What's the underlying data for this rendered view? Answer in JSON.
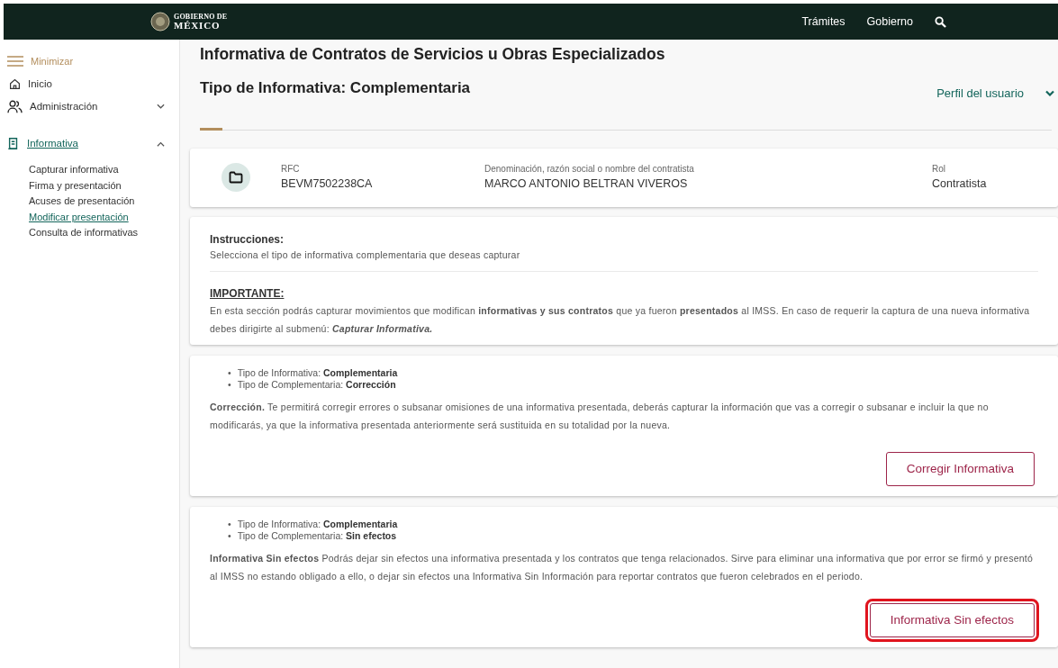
{
  "header": {
    "logo": {
      "line1": "GOBIERNO DE",
      "line2": "MÉXICO"
    },
    "links": [
      "Trámites",
      "Gobierno"
    ]
  },
  "sidebar": {
    "minimize": "Minimizar",
    "items": [
      {
        "label": "Inicio",
        "kind": "home",
        "selected": false
      },
      {
        "label": "Administración",
        "kind": "group",
        "selected": false,
        "expanded": false
      },
      {
        "label": "Informativa",
        "kind": "section",
        "selected": true,
        "expanded": true,
        "children": [
          {
            "label": "Capturar informativa",
            "selected": false
          },
          {
            "label": "Firma y presentación",
            "selected": false
          },
          {
            "label": "Acuses de presentación",
            "selected": false
          },
          {
            "label": "Modificar presentación",
            "selected": true
          },
          {
            "label": "Consulta de informativas",
            "selected": false
          }
        ]
      }
    ]
  },
  "page": {
    "title": "Informativa de Contratos de Servicios u Obras Especializados",
    "subtitle": "Tipo de Informativa: Complementaria",
    "profile": "Perfil del usuario"
  },
  "contractor": {
    "fields": [
      {
        "label": "RFC",
        "value": "BEVM7502238CA"
      },
      {
        "label": "Denominación, razón social o nombre del contratista",
        "value": "MARCO ANTONIO BELTRAN VIVEROS"
      },
      {
        "label": "Rol",
        "value": "Contratista"
      }
    ]
  },
  "instructions": {
    "title": "Instrucciones:",
    "text": "Selecciona el tipo de informativa complementaria que deseas capturar",
    "important_title": "IMPORTANTE:",
    "important_text": "En esta sección podrás capturar movimientos que modifican **informativas y sus contratos** que ya fueron **presentados** al IMSS. En caso de requerir la captura de una nueva informativa debes dirigirte al submenú: **Capturar Informativa.**"
  },
  "options": [
    {
      "bullets": [
        {
          "marker": "•",
          "label": "Tipo de Informativa:",
          "value": "Complementaria"
        },
        {
          "marker": "•",
          "label": "Tipo de Complementaria:",
          "value": "Corrección"
        }
      ],
      "description": "**Corrección.** Te permitirá corregir errores o subsanar omisiones de una informativa presentada, deberás capturar la información que vas a corregir o subsanar e incluir la que no modificarás, ya que la informativa presentada anteriormente será sustituida en su totalidad por la nueva.",
      "button": "Corregir Informativa",
      "highlighted": false
    },
    {
      "bullets": [
        {
          "marker": "•",
          "label": "Tipo de Informativa:",
          "value": "Complementaria"
        },
        {
          "marker": "•",
          "label": "Tipo de Complementaria:",
          "value": "Sin efectos"
        }
      ],
      "description": "**Informativa Sin efectos** Podrás dejar sin efectos una informativa presentada y los contratos que tenga relacionados. Sirve para eliminar una informativa que por error se firmó y presentó al IMSS no estando obligado a ello, o dejar sin efectos una Informativa Sin Información para reportar contratos que fueron celebrados en el periodo.",
      "button": "Informativa Sin efectos",
      "highlighted": true
    }
  ]
}
